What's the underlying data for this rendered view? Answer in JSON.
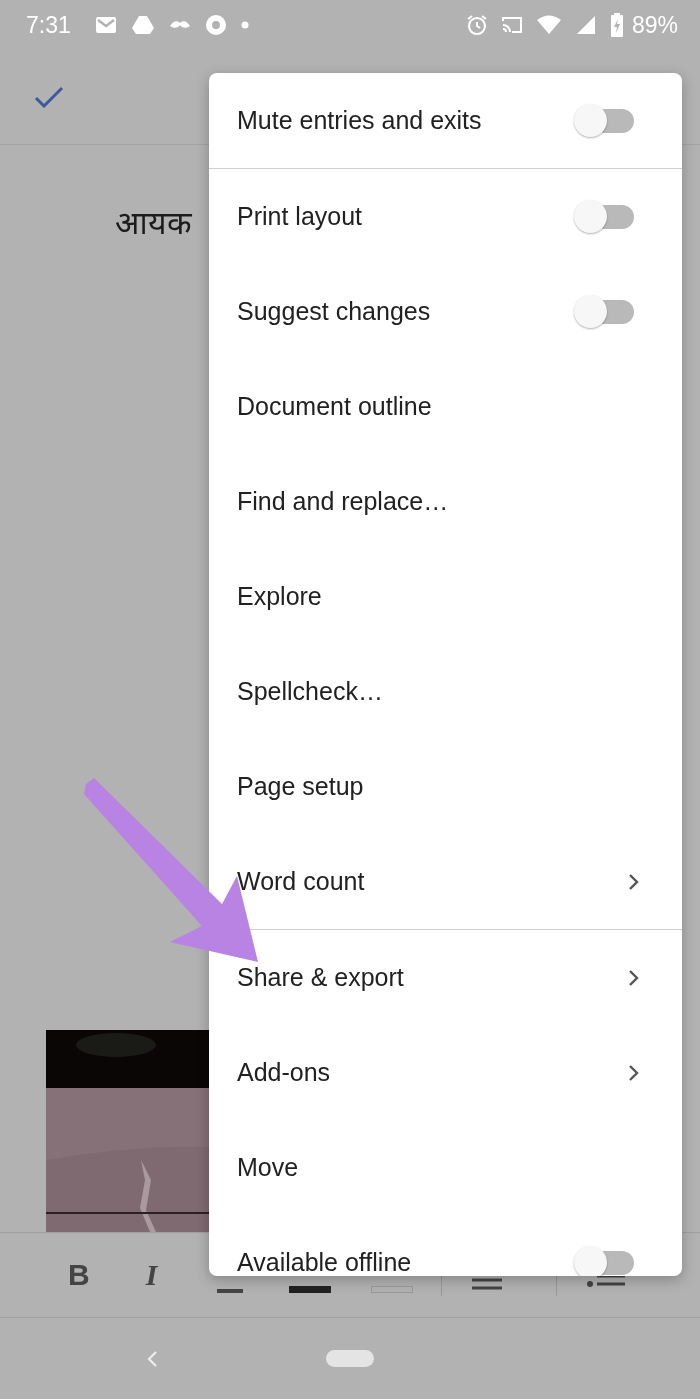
{
  "status_bar": {
    "time": "7:31",
    "battery": "89%"
  },
  "document": {
    "title": "आयक"
  },
  "toolbar": {
    "bold": "B",
    "italic": "I"
  },
  "menu": {
    "items": [
      {
        "kind": "toggle",
        "label": "Mute entries and exits",
        "on": false,
        "divider_after": true
      },
      {
        "kind": "toggle",
        "label": "Print layout",
        "on": false
      },
      {
        "kind": "toggle",
        "label": "Suggest changes",
        "on": false
      },
      {
        "kind": "plain",
        "label": "Document outline"
      },
      {
        "kind": "plain",
        "label": "Find and replace…"
      },
      {
        "kind": "plain",
        "label": "Explore"
      },
      {
        "kind": "plain",
        "label": "Spellcheck…"
      },
      {
        "kind": "plain",
        "label": "Page setup"
      },
      {
        "kind": "submenu",
        "label": "Word count",
        "divider_after": true
      },
      {
        "kind": "submenu",
        "label": "Share & export"
      },
      {
        "kind": "submenu",
        "label": "Add-ons"
      },
      {
        "kind": "plain",
        "label": "Move"
      },
      {
        "kind": "toggle",
        "label": "Available offline",
        "on": false
      }
    ]
  }
}
